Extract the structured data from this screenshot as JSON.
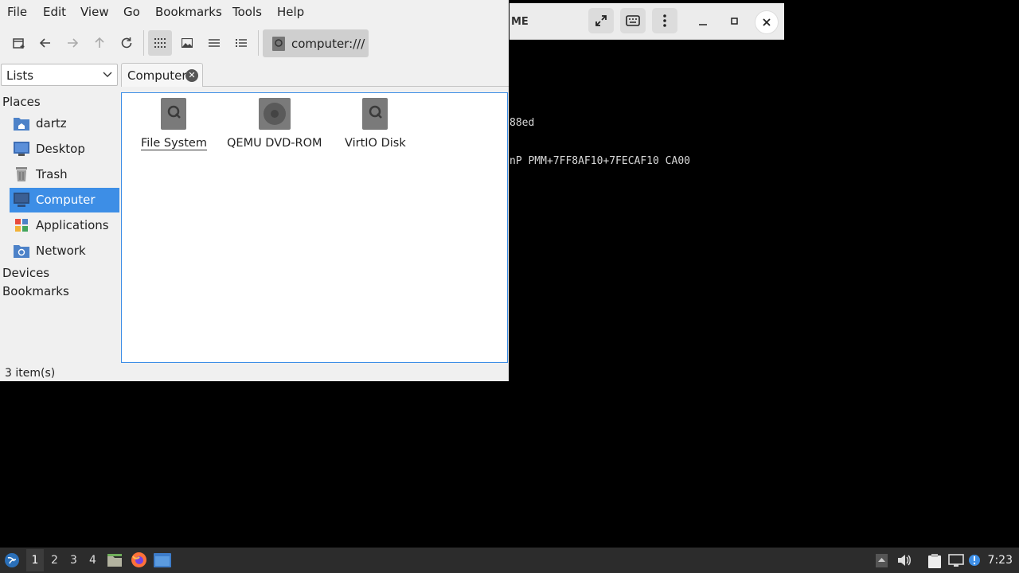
{
  "viewer": {
    "title_fragment": "ME",
    "line1": "88ed",
    "line2": "nP PMM+7FF8AF10+7FECAF10 CA00"
  },
  "menu": [
    "File",
    "Edit",
    "View",
    "Go",
    "Bookmarks",
    "Tools",
    "Help"
  ],
  "location": {
    "path": "computer:///"
  },
  "side_panel": {
    "selected": "Lists"
  },
  "tab": {
    "label": "Computer"
  },
  "sidebar": {
    "places_label": "Places",
    "items": [
      {
        "label": "dartz",
        "icon": "home-folder-icon"
      },
      {
        "label": "Desktop",
        "icon": "desktop-icon"
      },
      {
        "label": "Trash",
        "icon": "trash-icon"
      },
      {
        "label": "Computer",
        "icon": "computer-icon",
        "selected": true
      },
      {
        "label": "Applications",
        "icon": "applications-icon"
      },
      {
        "label": "Network",
        "icon": "network-icon"
      }
    ],
    "devices_label": "Devices",
    "bookmarks_label": "Bookmarks"
  },
  "drives": [
    {
      "label": "File System",
      "icon": "harddisk-icon"
    },
    {
      "label": "QEMU DVD-ROM",
      "icon": "optical-drive-icon"
    },
    {
      "label": "VirtIO Disk",
      "icon": "harddisk-icon"
    }
  ],
  "status": {
    "text": "3 item(s)"
  },
  "taskbar": {
    "workspaces": [
      "1",
      "2",
      "3",
      "4"
    ],
    "clock": "7:23"
  },
  "colors": {
    "accent": "#3d8ee6",
    "taskbar": "#2c2c2c"
  }
}
